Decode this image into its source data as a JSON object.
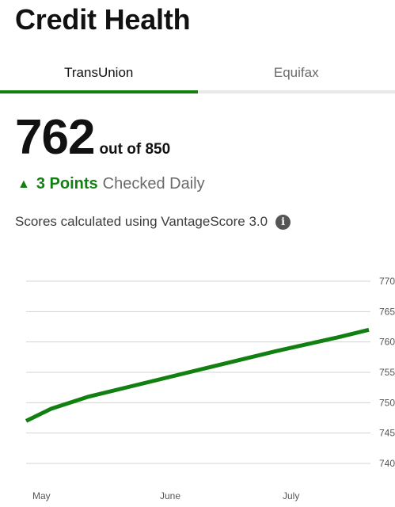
{
  "header": {
    "title": "Credit Health"
  },
  "tabs": [
    {
      "label": "TransUnion",
      "active": true
    },
    {
      "label": "Equifax",
      "active": false
    }
  ],
  "score": {
    "value": "762",
    "out_of": "out of 850"
  },
  "change": {
    "arrow_icon": "triangle-up-icon",
    "points": "3 Points",
    "note": "Checked Daily"
  },
  "source": {
    "text": "Scores calculated using VantageScore 3.0",
    "info_icon": "i"
  },
  "colors": {
    "accent": "#118011",
    "grid": "#d3d3d3"
  },
  "chart_data": {
    "type": "line",
    "x_ticks": [
      "May",
      "June",
      "July"
    ],
    "y_ticks": [
      740,
      745,
      750,
      755,
      760,
      765,
      770
    ],
    "ylim": [
      740,
      770
    ],
    "grid": true,
    "series": [
      {
        "x": [
          0.0,
          0.2,
          0.5,
          1.0,
          1.5,
          2.0,
          2.5,
          2.85
        ],
        "values": [
          747,
          749,
          751,
          753.5,
          756,
          758.5,
          760.8,
          762
        ]
      }
    ]
  }
}
